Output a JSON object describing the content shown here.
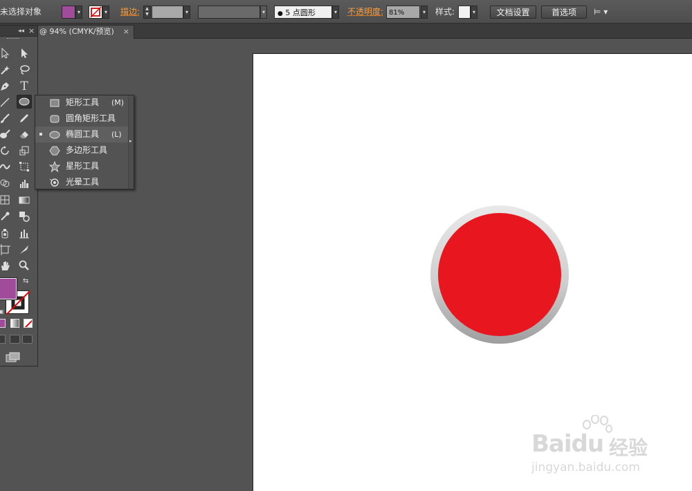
{
  "control_bar": {
    "no_selection_label": "未选择对象",
    "fill_color": "#a04c9a",
    "stroke_label": "描边:",
    "brush_definition": "5 点圆形",
    "opacity_label": "不透明度:",
    "opacity_value": "81%",
    "style_label": "样式:",
    "doc_setup_button": "文档设置",
    "preferences_button": "首选项"
  },
  "tab_bar": {
    "doc_tab_title": "@ 94% (CMYK/预览)",
    "close_glyph": "×"
  },
  "tools_panel": {
    "collapse_glyph": "◂◂",
    "close_glyph": "×",
    "fill_swatch_color": "#a04c9a"
  },
  "shape_flyout": {
    "items": [
      {
        "label": "矩形工具",
        "key": "(M)",
        "icon": "rectangle-icon"
      },
      {
        "label": "圆角矩形工具",
        "key": "",
        "icon": "rounded-rectangle-icon"
      },
      {
        "label": "椭圆工具",
        "key": "(L)",
        "icon": "ellipse-icon",
        "selected": true
      },
      {
        "label": "多边形工具",
        "key": "",
        "icon": "polygon-icon"
      },
      {
        "label": "星形工具",
        "key": "",
        "icon": "star-icon"
      },
      {
        "label": "光晕工具",
        "key": "",
        "icon": "flare-icon"
      }
    ]
  },
  "canvas": {
    "button_fill_color": "#e8161f",
    "button_ring_color": "#d4d4d4"
  },
  "watermark": {
    "brand": "Baidu",
    "brand_cn": "经验",
    "url": "jingyan.baidu.com"
  }
}
